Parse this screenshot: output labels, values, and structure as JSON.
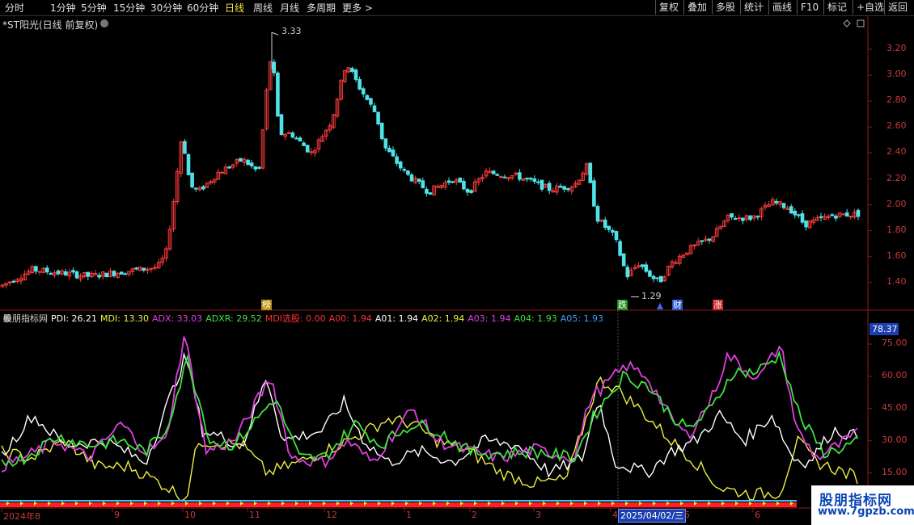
{
  "toolbar": {
    "periods": [
      "分时",
      "1分钟",
      "5分钟",
      "15分钟",
      "30分钟",
      "60分钟",
      "日线",
      "周线",
      "月线",
      "多周期",
      "更多 >"
    ],
    "active_period": "日线",
    "right_buttons": [
      "复权",
      "叠加",
      "多股",
      "统计",
      "画线",
      "F10",
      "标记",
      "+自选",
      "返回"
    ]
  },
  "price_panel": {
    "title": "*ST阳光(日线 前复权)",
    "high_label": "3.33",
    "low_label": "1.29",
    "badges": [
      {
        "text": "榜",
        "color": "#b8860b"
      },
      {
        "text": "跌",
        "color": "#1e8c1e"
      },
      {
        "text": "财",
        "color": "#2a55c8"
      },
      {
        "text": "涨",
        "color": "#c81e1e"
      }
    ],
    "y_axis": [
      "3.20",
      "3.00",
      "2.80",
      "2.60",
      "2.40",
      "2.20",
      "2.00",
      "1.80",
      "1.60",
      "1.40"
    ]
  },
  "indicator_panel": {
    "legend": [
      {
        "label": "股朋指标网",
        "color": "#d0d0d0"
      },
      {
        "label": "PDI: 26.21",
        "color": "#ffffff"
      },
      {
        "label": "MDI: 13.30",
        "color": "#f0f040"
      },
      {
        "label": "ADX: 33.03",
        "color": "#e040e0"
      },
      {
        "label": "ADXR: 29.52",
        "color": "#40e040"
      },
      {
        "label": "MDI选股: 0.00",
        "color": "#ff3030"
      },
      {
        "label": "A00: 1.94",
        "color": "#ff3030"
      },
      {
        "label": "A01: 1.94",
        "color": "#ffffff"
      },
      {
        "label": "A02: 1.94",
        "color": "#f0f040"
      },
      {
        "label": "A03: 1.94",
        "color": "#e040e0"
      },
      {
        "label": "A04: 1.93",
        "color": "#40e040"
      },
      {
        "label": "A05: 1.93",
        "color": "#40a0ff"
      }
    ],
    "current_value": "78.37",
    "y_axis": [
      "75.00",
      "60.00",
      "45.00",
      "30.00",
      "15.00"
    ]
  },
  "x_axis": {
    "labels": [
      "2024年8",
      "9",
      "10",
      "11",
      "12",
      "1",
      "2",
      "3",
      "4",
      "5",
      "6"
    ],
    "cursor_date": "2025/04/02/三"
  },
  "watermark": {
    "line1": "股朋指标网",
    "line2": "www.7gpzb.com"
  }
}
